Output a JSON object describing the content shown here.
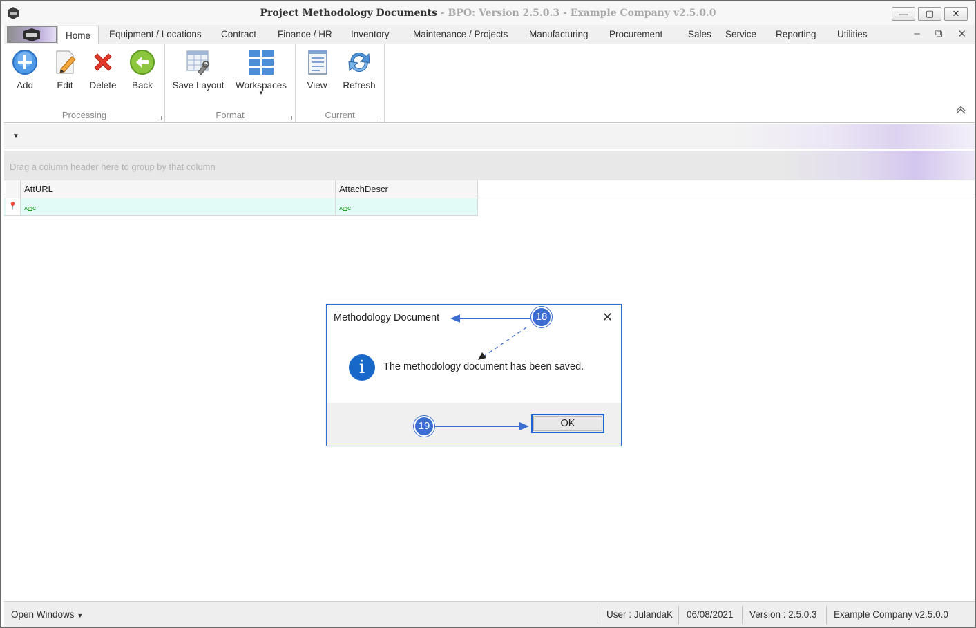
{
  "window": {
    "title_main": "Project Methodology Documents",
    "title_sub": " - BPO: Version 2.5.0.3 - Example Company v2.5.0.0",
    "minimize": "—",
    "restore": "▢",
    "close": "✕"
  },
  "tabs": [
    {
      "label": "Home",
      "active": true
    },
    {
      "label": "Equipment / Locations"
    },
    {
      "label": "Contract"
    },
    {
      "label": "Finance / HR"
    },
    {
      "label": "Inventory"
    },
    {
      "label": "Maintenance / Projects"
    },
    {
      "label": "Manufacturing"
    },
    {
      "label": "Procurement"
    },
    {
      "label": "Sales"
    },
    {
      "label": "Service"
    },
    {
      "label": "Reporting"
    },
    {
      "label": "Utilities"
    }
  ],
  "mdi": {
    "minimize": "–",
    "restore": "⧉",
    "close": "✕"
  },
  "ribbon": {
    "processing": {
      "label": "Processing",
      "add": "Add",
      "edit": "Edit",
      "delete": "Delete",
      "back": "Back"
    },
    "format": {
      "label": "Format",
      "save_layout": "Save Layout",
      "workspaces": "Workspaces"
    },
    "current": {
      "label": "Current",
      "view": "View",
      "refresh": "Refresh"
    }
  },
  "grid": {
    "group_hint": "Drag a column header here to group by that column",
    "columns": [
      "AttURL",
      "AttachDescr"
    ]
  },
  "dialog": {
    "title": "Methodology Document",
    "message": "The methodology document has been saved.",
    "ok": "OK",
    "close": "✕"
  },
  "callouts": {
    "c18": "18",
    "c19": "19"
  },
  "status": {
    "open_windows": "Open Windows",
    "user": "User : JulandaK",
    "date": "06/08/2021",
    "version": "Version : 2.5.0.3",
    "company": "Example Company v2.5.0.0"
  },
  "colors": {
    "accent": "#3c6ed2",
    "info": "#1768c9",
    "row_highlight": "#e3fbf7"
  }
}
